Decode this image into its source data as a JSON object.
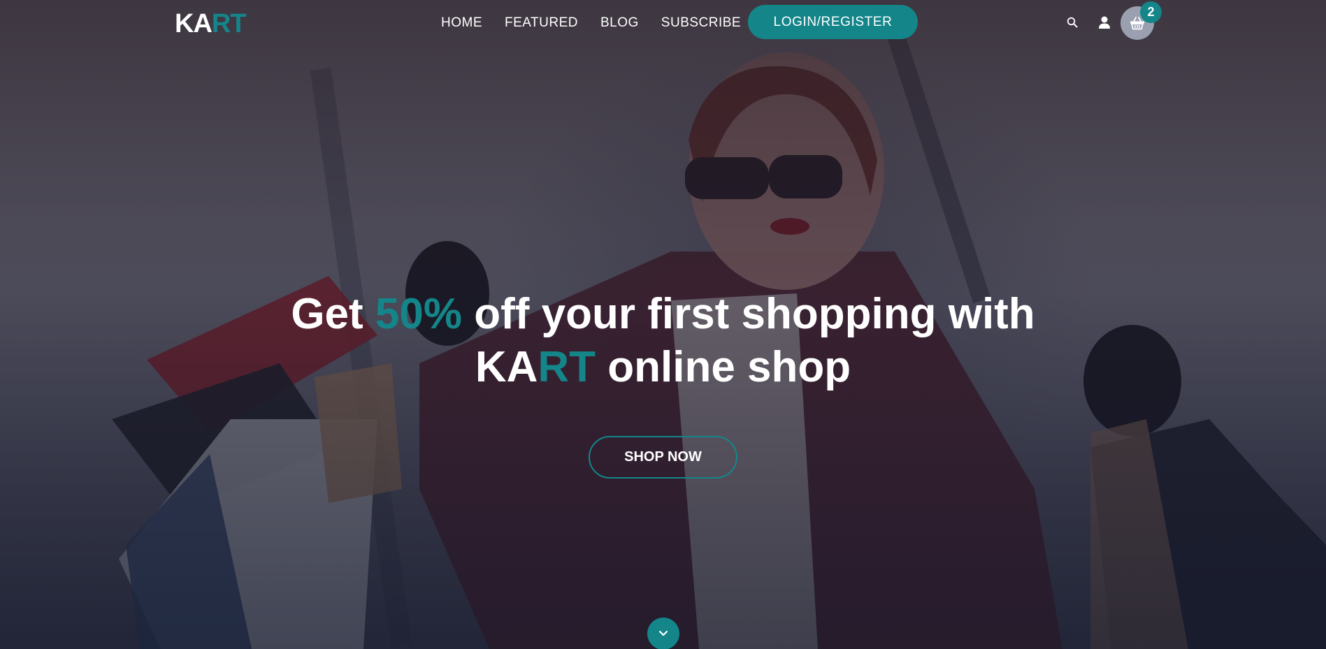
{
  "brand": {
    "logo_part1": "KA",
    "logo_part2": "RT",
    "accent_color": "#14868a"
  },
  "nav": {
    "items": [
      {
        "label": "HOME"
      },
      {
        "label": "FEATURED"
      },
      {
        "label": "BLOG"
      },
      {
        "label": "SUBSCRIBE"
      }
    ],
    "login_label": "LOGIN/REGISTER",
    "icons": [
      "search-icon",
      "user-icon",
      "basket-icon"
    ],
    "cart_count": "2"
  },
  "hero": {
    "headline_part1": "Get ",
    "headline_highlight": "50%",
    "headline_part2": " off your first shopping with",
    "brand_part1": "KA",
    "brand_part2": "RT",
    "headline_part3": " online shop",
    "cta_label": "SHOP NOW",
    "scroll_icon": "chevron-down-icon",
    "image": "woman-with-shopping-bags"
  }
}
